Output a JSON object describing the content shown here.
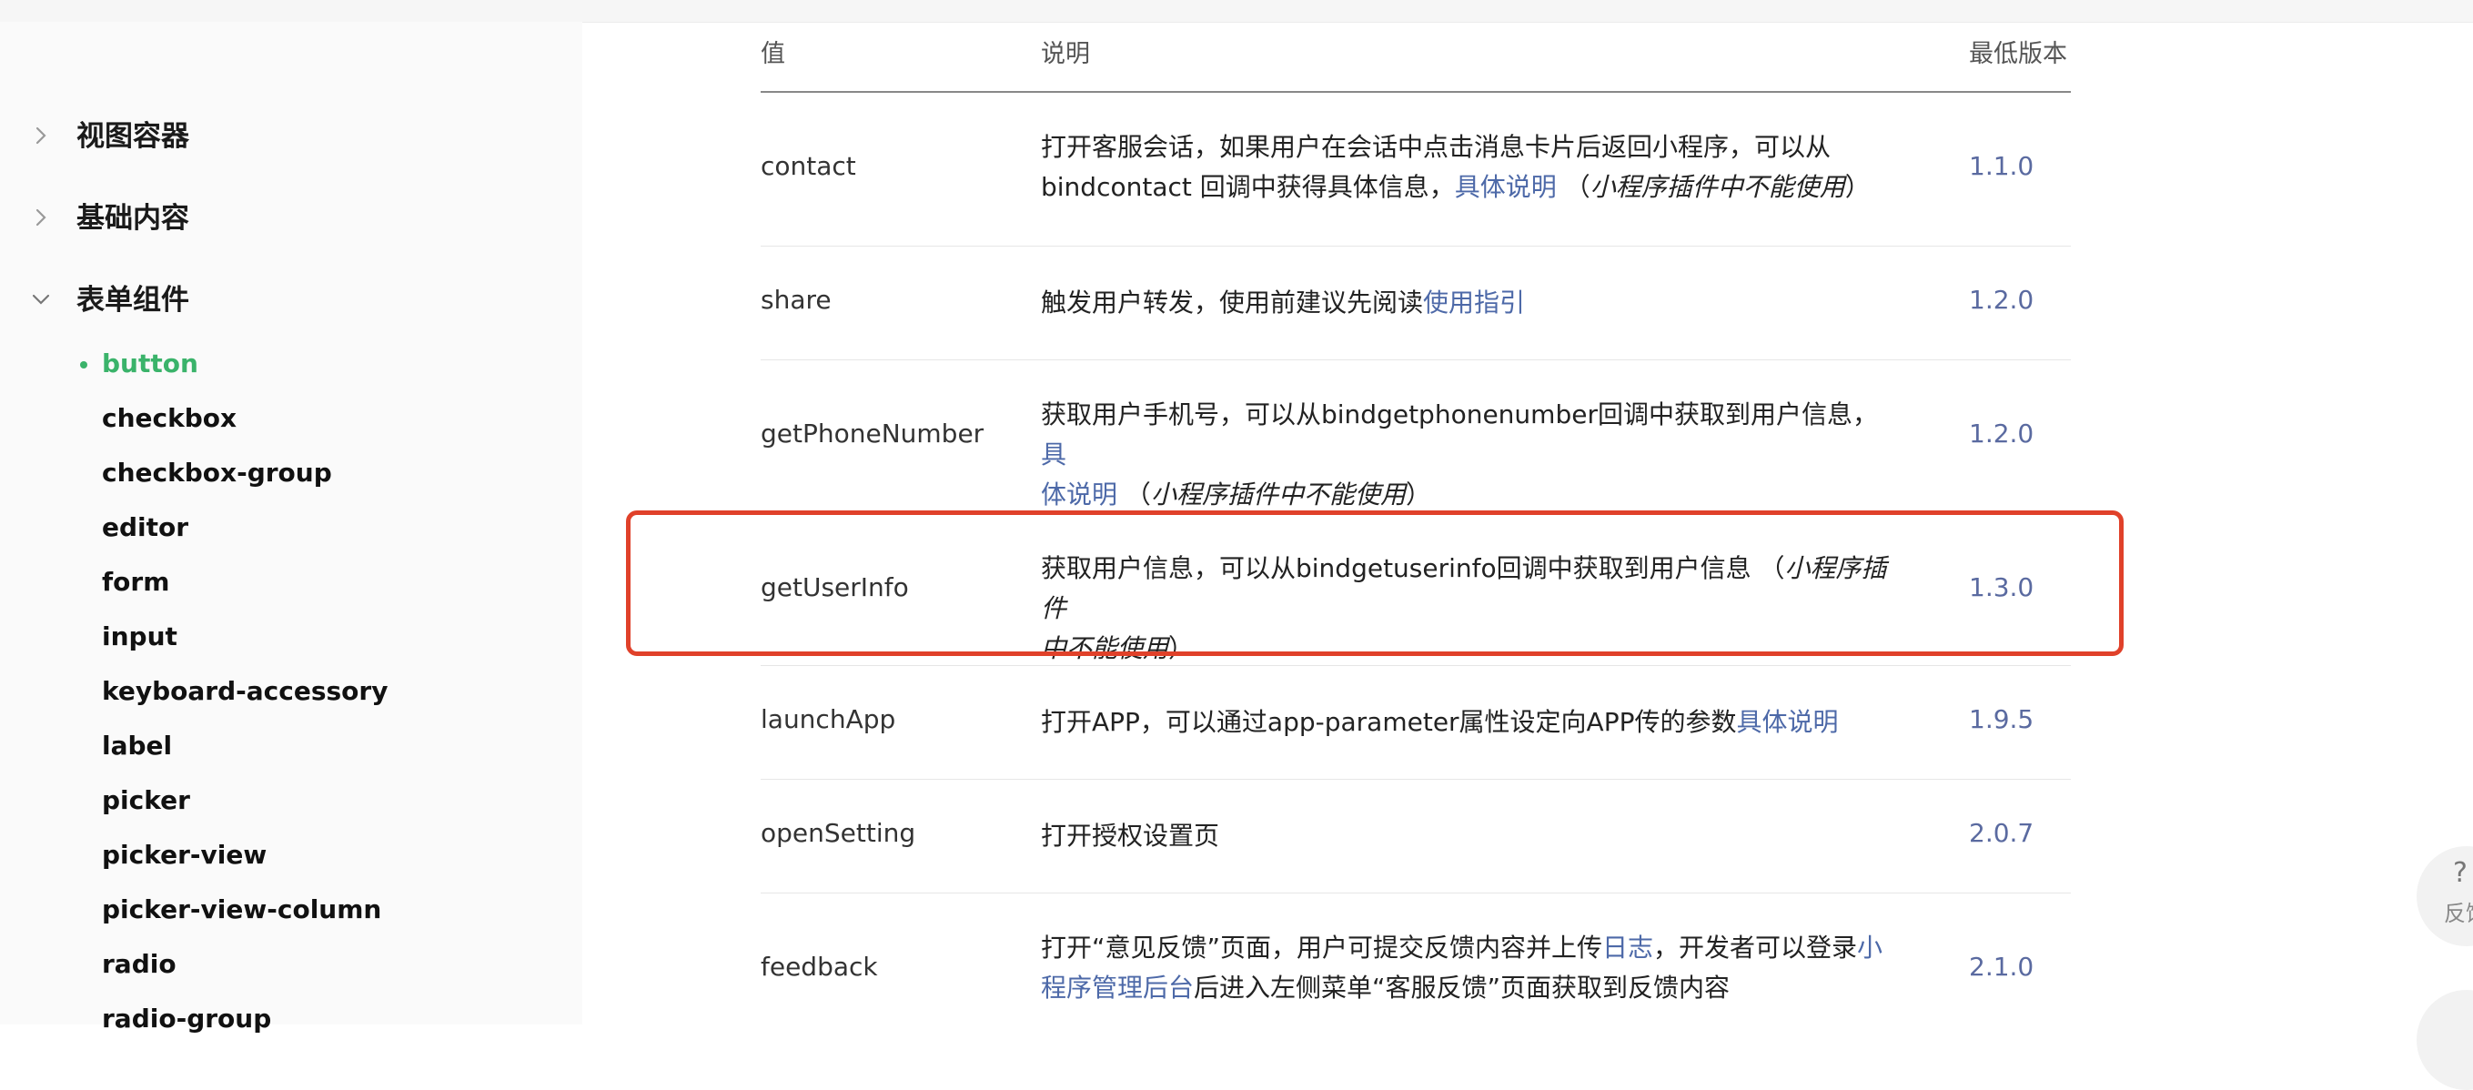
{
  "sidebar": {
    "sections": [
      {
        "label": "视图容器",
        "expanded": false
      },
      {
        "label": "基础内容",
        "expanded": false
      },
      {
        "label": "表单组件",
        "expanded": true
      }
    ],
    "items": [
      {
        "label": "button",
        "active": true
      },
      {
        "label": "checkbox"
      },
      {
        "label": "checkbox-group"
      },
      {
        "label": "editor"
      },
      {
        "label": "form"
      },
      {
        "label": "input"
      },
      {
        "label": "keyboard-accessory"
      },
      {
        "label": "label"
      },
      {
        "label": "picker"
      },
      {
        "label": "picker-view"
      },
      {
        "label": "picker-view-column"
      },
      {
        "label": "radio"
      },
      {
        "label": "radio-group"
      }
    ]
  },
  "table": {
    "headers": {
      "value": "值",
      "desc": "说明",
      "version": "最低版本"
    },
    "rows": [
      {
        "value": "contact",
        "desc_1": "打开客服会话，如果用户在会话中点击消息卡片后返回小程序，可以从",
        "desc_2": "bindcontact 回调中获得具体信息，",
        "link": "具体说明",
        "note": "（",
        "note_it": "小程序插件中不能使用",
        "note_end": "）",
        "version": "1.1.0"
      },
      {
        "value": "share",
        "desc_1": "触发用户转发，使用前建议先阅读",
        "link": "使用指引",
        "version": "1.2.0"
      },
      {
        "value": "getPhoneNumber",
        "desc_1": "获取用户手机号，可以从bindgetphonenumber回调中获取到用户信息，",
        "link_a": "具",
        "link_b": "体说明",
        "note": "（",
        "note_it": "小程序插件中不能使用",
        "note_end": "）",
        "version": "1.2.0"
      },
      {
        "value": "getUserInfo",
        "desc_1": "获取用户信息，可以从bindgetuserinfo回调中获取到用户信息 （",
        "note_it_a": "小程序插件",
        "note_it_b": "中不能使用",
        "note_end": "）",
        "version": "1.3.0"
      },
      {
        "value": "launchApp",
        "desc_1": "打开APP，可以通过app-parameter属性设定向APP传的参数",
        "link": "具体说明",
        "version": "1.9.5"
      },
      {
        "value": "openSetting",
        "desc_1": "打开授权设置页",
        "version": "2.0.7"
      },
      {
        "value": "feedback",
        "desc_1": "打开“意见反馈”页面，用户可提交反馈内容并上传",
        "link_log": "日志",
        "desc_mid": "，开发者可以登录",
        "link_a": "小",
        "link_b": "程序管理后台",
        "desc_2": "后进入左侧菜单“客服反馈”页面获取到反馈内容",
        "version": "2.1.0"
      }
    ]
  },
  "fab": {
    "icon": "?",
    "label": "反馈"
  },
  "colors": {
    "accent": "#3ab36a",
    "link": "#4d69a8",
    "highlight": "#e0412a"
  }
}
